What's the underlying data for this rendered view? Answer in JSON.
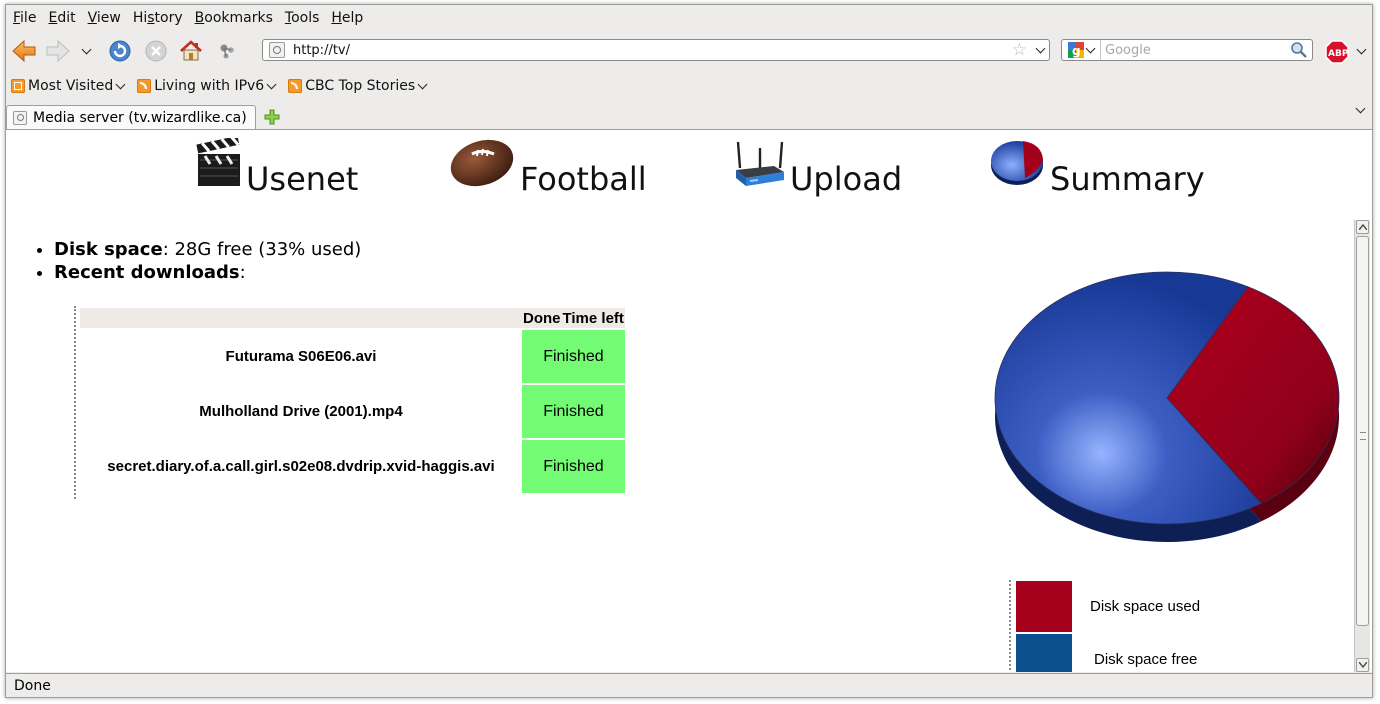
{
  "menu": [
    "File",
    "Edit",
    "View",
    "History",
    "Bookmarks",
    "Tools",
    "Help"
  ],
  "navbar": {
    "url": "http://tv/",
    "search_placeholder": "Google"
  },
  "bookmarks": [
    {
      "label": "Most Visited"
    },
    {
      "label": "Living with IPv6"
    },
    {
      "label": "CBC Top Stories"
    }
  ],
  "tab": {
    "title": "Media server (tv.wizardlike.ca)"
  },
  "nav": [
    {
      "label": "Usenet",
      "icon": "clapperboard-icon"
    },
    {
      "label": "Football",
      "icon": "football-icon"
    },
    {
      "label": "Upload",
      "icon": "router-icon"
    },
    {
      "label": "Summary",
      "icon": "pie-icon"
    }
  ],
  "info": {
    "disk_label": "Disk space",
    "disk_value": ": 28G free (33% used)",
    "recent_label": "Recent downloads",
    "recent_suffix": ":"
  },
  "downloads": {
    "headers": [
      "",
      "Done",
      "Time left"
    ],
    "rows": [
      {
        "name": "Futurama S06E06.avi",
        "status": "Finished"
      },
      {
        "name": "Mulholland Drive (2001).mp4",
        "status": "Finished"
      },
      {
        "name": "secret.diary.of.a.call.girl.s02e08.dvdrip.xvid-haggis.avi",
        "status": "Finished"
      }
    ]
  },
  "chart_data": {
    "type": "pie",
    "slices": [
      {
        "label": "Disk space used",
        "value": 33,
        "color": "#a5001c"
      },
      {
        "label": "Disk space free",
        "value": 67,
        "color": "#0b4f8f"
      }
    ]
  },
  "legend": [
    {
      "label": "Disk space used",
      "color": "#a5001c"
    },
    {
      "label": "Disk space free",
      "color": "#0b4f8f"
    }
  ],
  "status": "Done"
}
